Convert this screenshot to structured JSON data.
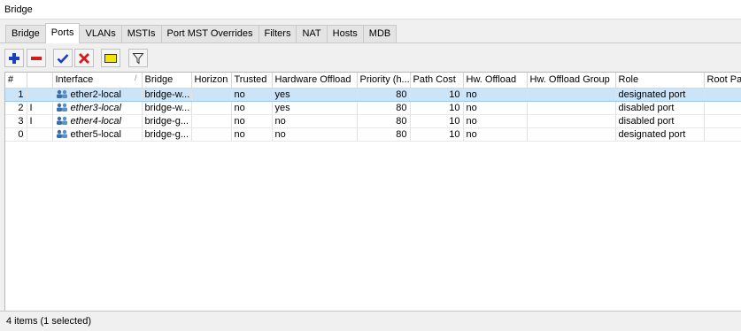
{
  "window": {
    "title": "Bridge"
  },
  "tabs": [
    {
      "label": "Bridge",
      "active": false
    },
    {
      "label": "Ports",
      "active": true
    },
    {
      "label": "VLANs",
      "active": false
    },
    {
      "label": "MSTIs",
      "active": false
    },
    {
      "label": "Port MST Overrides",
      "active": false
    },
    {
      "label": "Filters",
      "active": false
    },
    {
      "label": "NAT",
      "active": false
    },
    {
      "label": "Hosts",
      "active": false
    },
    {
      "label": "MDB",
      "active": false
    }
  ],
  "toolbar": {
    "add_icon": "plus-icon",
    "remove_icon": "minus-icon",
    "enable_icon": "check-icon",
    "disable_icon": "x-icon",
    "comment_icon": "comment-icon",
    "filter_icon": "filter-icon",
    "colors": {
      "add": "#1a3fbf",
      "remove": "#d21b1b",
      "enable": "#1a3fbf",
      "disable": "#d21b1b",
      "comment": "#f5e400"
    }
  },
  "table": {
    "columns": [
      "#",
      "",
      "Interface",
      "Bridge",
      "Horizon",
      "Trusted",
      "Hardware Offload",
      "Priority (h...",
      "Path Cost",
      "Hw. Offload",
      "Hw. Offload Group",
      "Role",
      "Root Pat"
    ],
    "sort_column_mark": "/",
    "rows": [
      {
        "num": "1",
        "flag": "",
        "interface": "ether2-local",
        "bridge": "bridge-w...",
        "horizon": "",
        "trusted": "no",
        "hardware_offload": "yes",
        "priority": "80",
        "path_cost": "10",
        "hw_offload": "no",
        "hw_offload_group": "",
        "role": "designated port",
        "root_path": "",
        "selected": true,
        "inactive": false
      },
      {
        "num": "2",
        "flag": "I",
        "interface": "ether3-local",
        "bridge": "bridge-w...",
        "horizon": "",
        "trusted": "no",
        "hardware_offload": "yes",
        "priority": "80",
        "path_cost": "10",
        "hw_offload": "no",
        "hw_offload_group": "",
        "role": "disabled port",
        "root_path": "",
        "selected": false,
        "inactive": true
      },
      {
        "num": "3",
        "flag": "I",
        "interface": "ether4-local",
        "bridge": "bridge-g...",
        "horizon": "",
        "trusted": "no",
        "hardware_offload": "no",
        "priority": "80",
        "path_cost": "10",
        "hw_offload": "no",
        "hw_offload_group": "",
        "role": "disabled port",
        "root_path": "",
        "selected": false,
        "inactive": true
      },
      {
        "num": "0",
        "flag": "",
        "interface": "ether5-local",
        "bridge": "bridge-g...",
        "horizon": "",
        "trusted": "no",
        "hardware_offload": "no",
        "priority": "80",
        "path_cost": "10",
        "hw_offload": "no",
        "hw_offload_group": "",
        "role": "designated port",
        "root_path": "",
        "selected": false,
        "inactive": false
      }
    ],
    "interface_icon": "network-port-icon"
  },
  "status": {
    "text": "4 items (1 selected)"
  }
}
